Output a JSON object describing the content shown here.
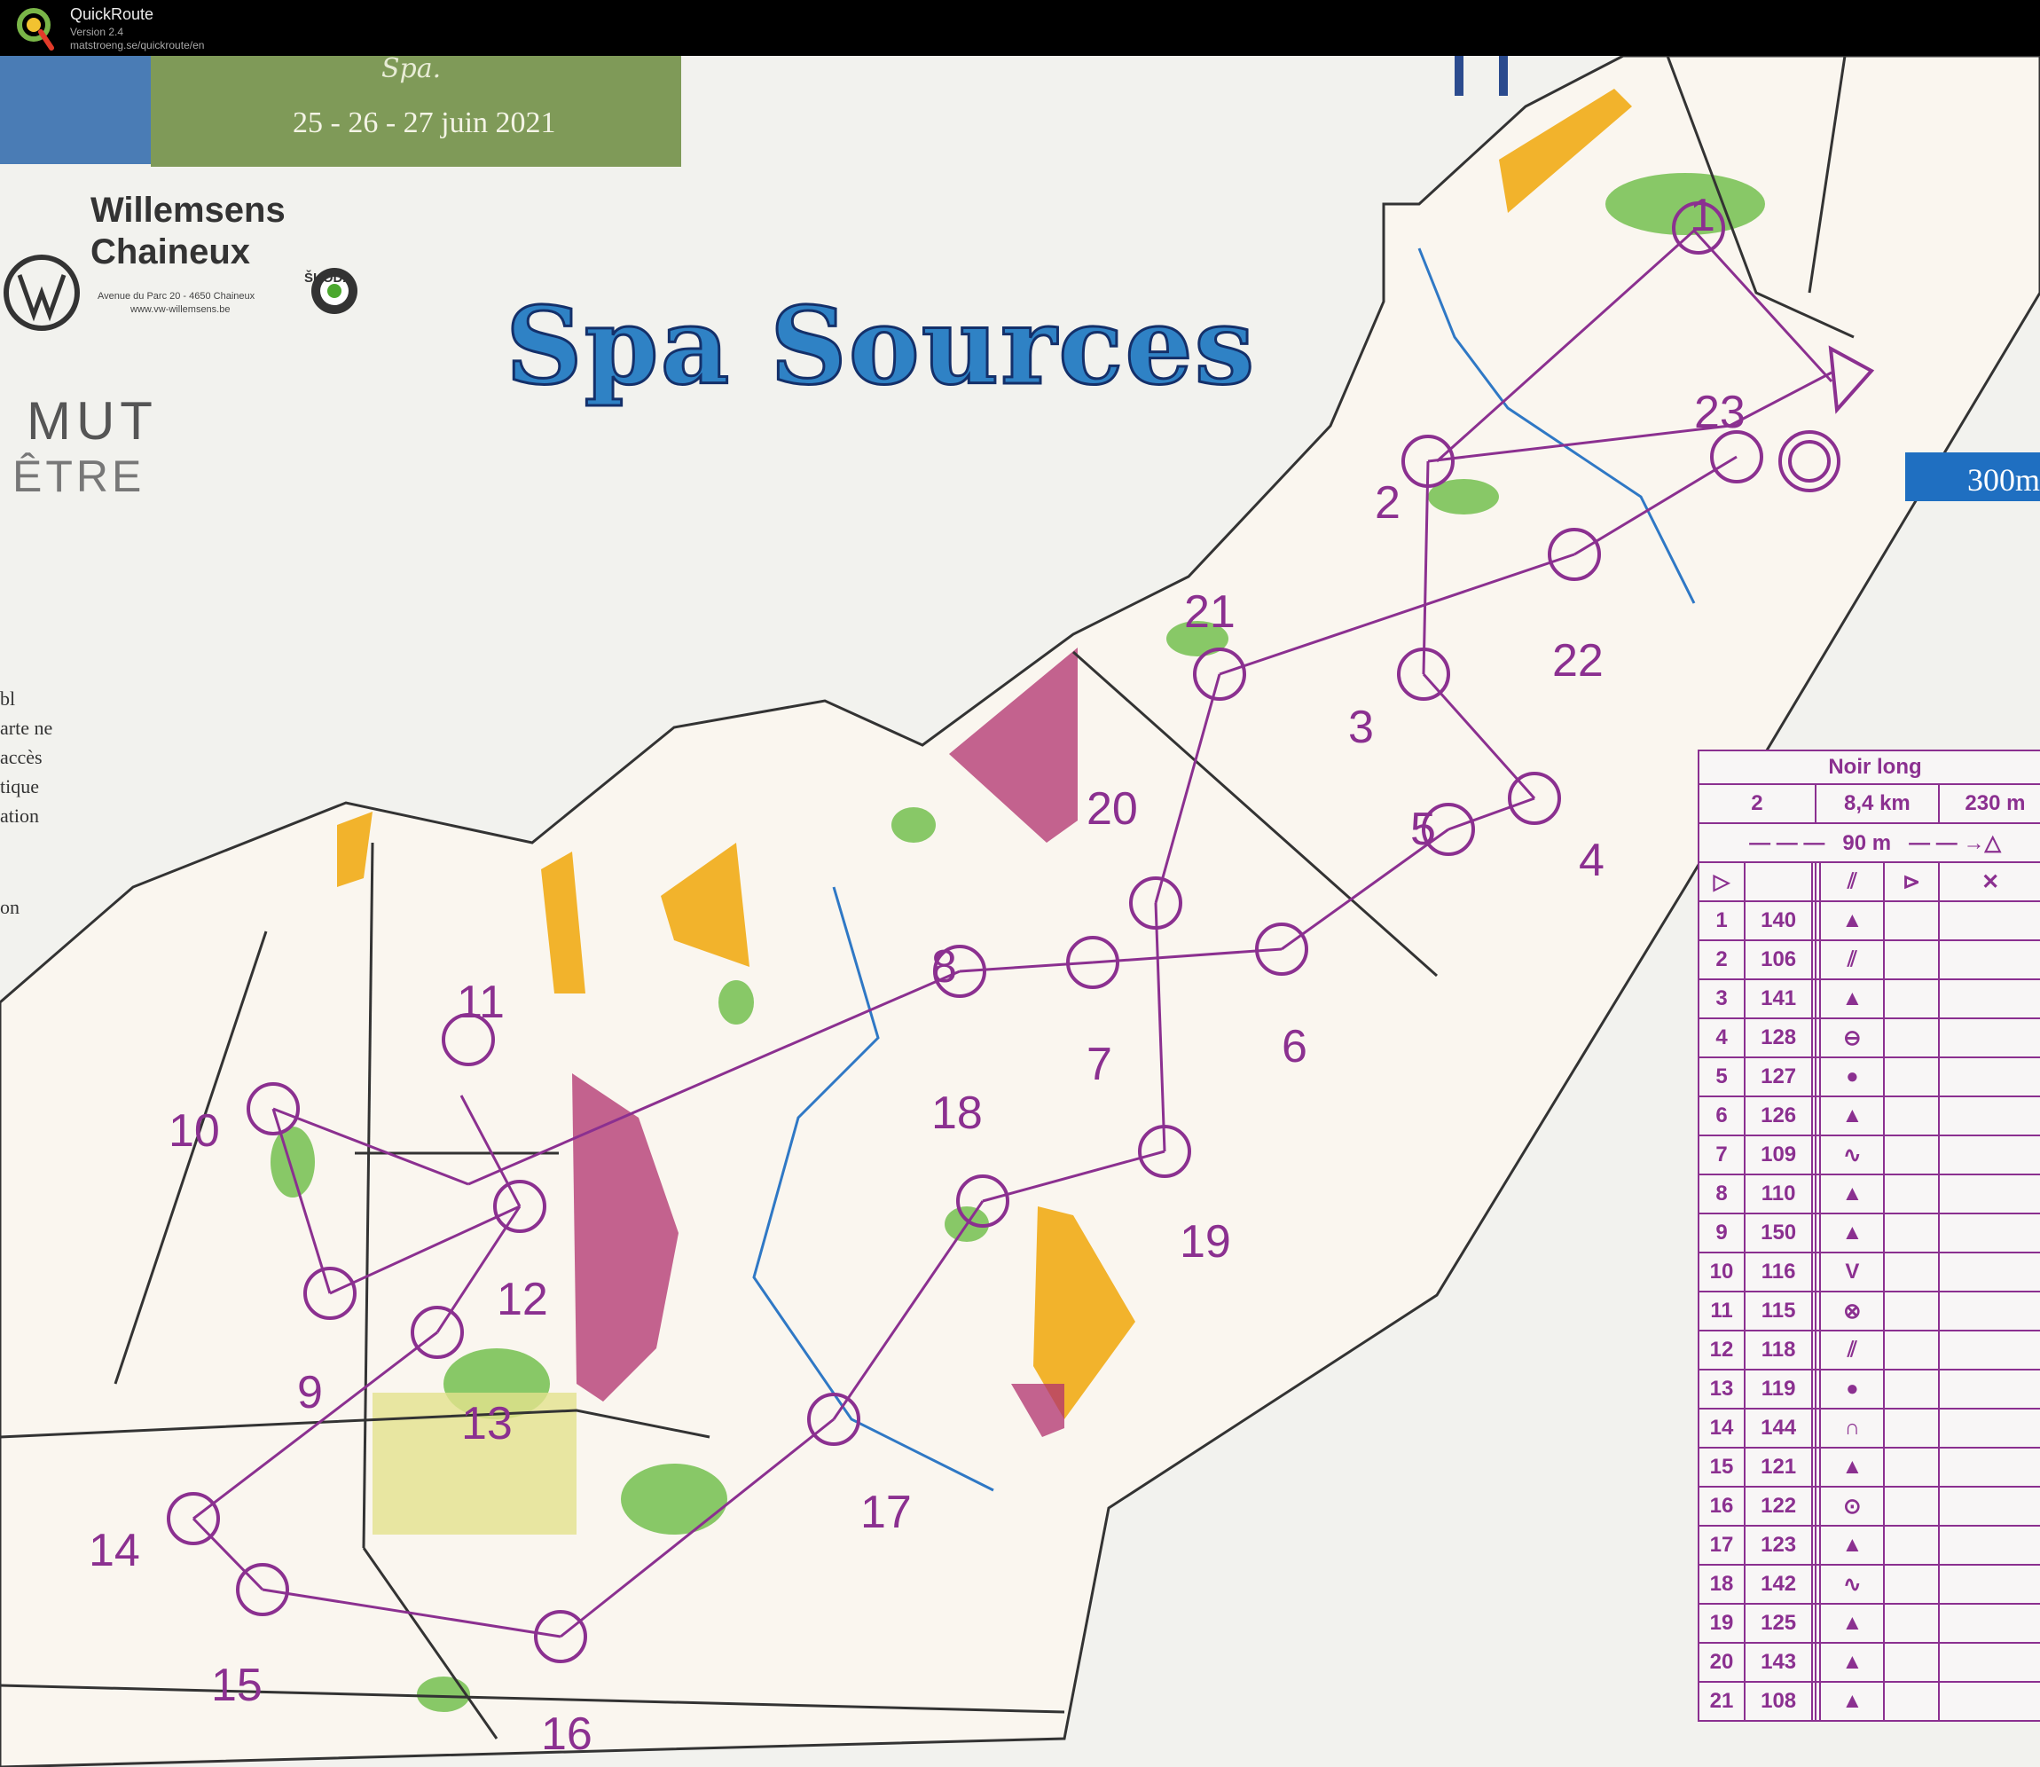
{
  "app": {
    "title": "QuickRoute",
    "version": "Version 2.4",
    "url": "matstroeng.se/quickroute/en"
  },
  "map": {
    "event_banner_subtitle": "Spa.",
    "event_dates": "25 - 26 - 27 juin 2021",
    "title": "Spa Sources",
    "sponsor": {
      "name_line1": "Willemsens",
      "name_line2": "Chaineux",
      "address": "Avenue du Parc 20 - 4650 Chaineux",
      "website": "www.vw-willemsens.be",
      "brand2": "ŠKODA"
    },
    "partner_text_line1": "MUT",
    "partner_text_line2": "ÊTRE",
    "cut_text": [
      "bl",
      "arte ne",
      "accès",
      "tique",
      "ation",
      "on"
    ],
    "scale_text": "300m",
    "colors": {
      "course_purple": "#8b3090",
      "title_blue": "#2f82c5",
      "banner_green": "#7f9a58",
      "yellow_open": "#f2b32c",
      "forest_green": "#6cbd45",
      "oob_magenta": "#b0306d"
    }
  },
  "course": {
    "controls": [
      {
        "number": "1"
      },
      {
        "number": "2"
      },
      {
        "number": "3"
      },
      {
        "number": "4"
      },
      {
        "number": "5"
      },
      {
        "number": "6"
      },
      {
        "number": "7"
      },
      {
        "number": "8"
      },
      {
        "number": "9"
      },
      {
        "number": "10"
      },
      {
        "number": "11"
      },
      {
        "number": "12"
      },
      {
        "number": "13"
      },
      {
        "number": "14"
      },
      {
        "number": "15"
      },
      {
        "number": "16"
      },
      {
        "number": "17"
      },
      {
        "number": "18"
      },
      {
        "number": "19"
      },
      {
        "number": "20"
      },
      {
        "number": "21"
      },
      {
        "number": "22"
      },
      {
        "number": "23"
      }
    ]
  },
  "description_sheet": {
    "course_name": "Noir long",
    "course_number": "2",
    "length": "8,4 km",
    "climb": "230 m",
    "taped_route": "90 m",
    "rows": [
      {
        "num": "1",
        "code": "140",
        "symbol": "▲"
      },
      {
        "num": "2",
        "code": "106",
        "symbol": "⫽"
      },
      {
        "num": "3",
        "code": "141",
        "symbol": "▲"
      },
      {
        "num": "4",
        "code": "128",
        "symbol": "⊖"
      },
      {
        "num": "5",
        "code": "127",
        "symbol": "●"
      },
      {
        "num": "6",
        "code": "126",
        "symbol": "▲"
      },
      {
        "num": "7",
        "code": "109",
        "symbol": "∿"
      },
      {
        "num": "8",
        "code": "110",
        "symbol": "▲"
      },
      {
        "num": "9",
        "code": "150",
        "symbol": "▲"
      },
      {
        "num": "10",
        "code": "116",
        "symbol": "V"
      },
      {
        "num": "11",
        "code": "115",
        "symbol": "⊗"
      },
      {
        "num": "12",
        "code": "118",
        "symbol": "⫽"
      },
      {
        "num": "13",
        "code": "119",
        "symbol": "●"
      },
      {
        "num": "14",
        "code": "144",
        "symbol": "∩"
      },
      {
        "num": "15",
        "code": "121",
        "symbol": "▲"
      },
      {
        "num": "16",
        "code": "122",
        "symbol": "⊙"
      },
      {
        "num": "17",
        "code": "123",
        "symbol": "▲"
      },
      {
        "num": "18",
        "code": "142",
        "symbol": "∿"
      },
      {
        "num": "19",
        "code": "125",
        "symbol": "▲"
      },
      {
        "num": "20",
        "code": "143",
        "symbol": "▲"
      },
      {
        "num": "21",
        "code": "108",
        "symbol": "▲"
      }
    ]
  }
}
